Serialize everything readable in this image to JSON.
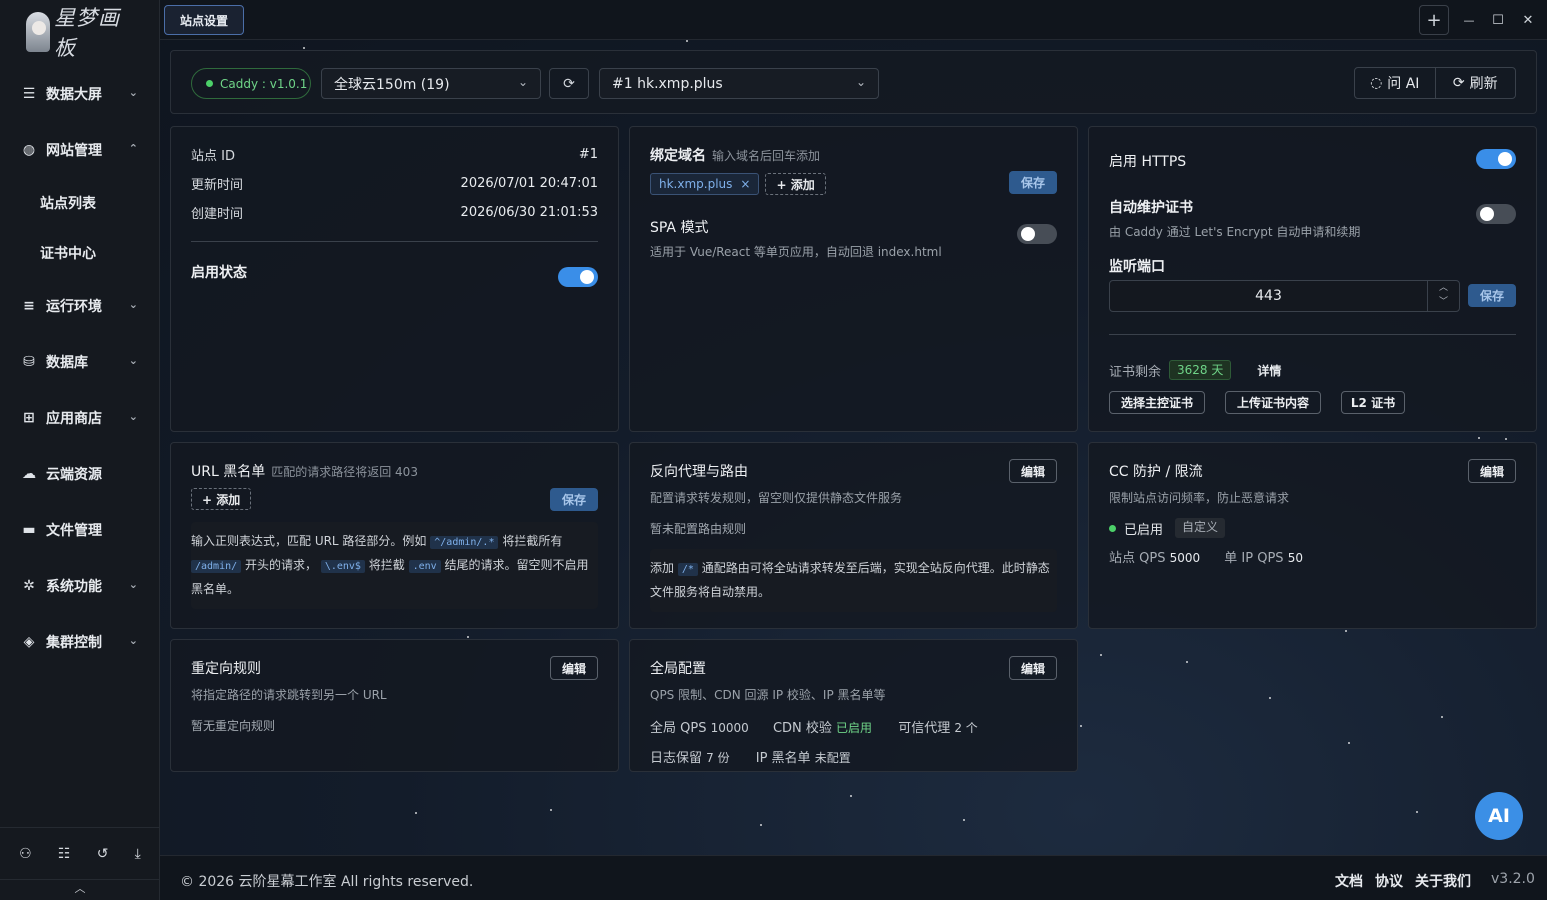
{
  "app": {
    "logo_text": "星梦画板"
  },
  "sidebar": {
    "items": [
      {
        "icon": "bar-chart-icon",
        "glyph": "☰",
        "label": "数据大屏",
        "chevron": "⌄"
      },
      {
        "icon": "globe-icon",
        "glyph": "◍",
        "label": "网站管理",
        "chevron": "⌃"
      },
      {
        "icon": "server-icon",
        "glyph": "≡",
        "label": "运行环境",
        "chevron": "⌄"
      },
      {
        "icon": "database-icon",
        "glyph": "⛁",
        "label": "数据库",
        "chevron": "⌄"
      },
      {
        "icon": "cart-icon",
        "glyph": "⊞",
        "label": "应用商店",
        "chevron": "⌄"
      },
      {
        "icon": "cloud-icon",
        "glyph": "☁",
        "label": "云端资源"
      },
      {
        "icon": "folder-icon",
        "glyph": "▬",
        "label": "文件管理"
      },
      {
        "icon": "gear-icon",
        "glyph": "✲",
        "label": "系统功能",
        "chevron": "⌄"
      },
      {
        "icon": "layers-icon",
        "glyph": "◈",
        "label": "集群控制",
        "chevron": "⌄"
      }
    ],
    "sub_items": [
      "站点列表",
      "证书中心"
    ],
    "footer_icons": [
      {
        "name": "network-icon",
        "glyph": "⚇"
      },
      {
        "name": "list-icon",
        "glyph": "☷"
      },
      {
        "name": "history-icon",
        "glyph": "↺"
      },
      {
        "name": "download-icon",
        "glyph": "⤓"
      }
    ],
    "collapse_glyph": "︿"
  },
  "topbar": {
    "tab_label": "站点设置",
    "plus": "+",
    "minimize": "—",
    "maximize": "☐",
    "close": "✕"
  },
  "toolbar": {
    "status": "Caddy : v1.0.1",
    "server_select": "全球云150m (19)",
    "refresh_glyph": "⟳",
    "site_select": "#1 hk.xmp.plus",
    "ask_ai": "问 AI",
    "refresh": "刷新",
    "chevron": "⌄"
  },
  "info": {
    "site_id_label": "站点 ID",
    "site_id": "#1",
    "updated_label": "更新时间",
    "updated": "2026/07/01 20:47:01",
    "created_label": "创建时间",
    "created": "2026/06/30 21:01:53",
    "enable_label": "启用状态",
    "enabled": true
  },
  "domain": {
    "title": "绑定域名",
    "hint": "输入域名后回车添加",
    "chip": "hk.xmp.plus",
    "add": "+ 添加",
    "save": "保存",
    "spa_title": "SPA 模式",
    "spa_desc": "适用于 Vue/React 等单页应用，自动回退 index.html",
    "spa_enabled": false
  },
  "https": {
    "title": "启用 HTTPS",
    "enabled": true,
    "auto_title": "自动维护证书",
    "auto_desc": "由 Caddy 通过 Let's Encrypt 自动申请和续期",
    "auto_enabled": false,
    "port_title": "监听端口",
    "port": "443",
    "save": "保存",
    "remain_label": "证书剩余",
    "remain": "3628 天",
    "detail": "详情",
    "btn_select": "选择主控证书",
    "btn_upload": "上传证书内容",
    "btn_l2": "L2 证书"
  },
  "blacklist": {
    "title": "URL 黑名单",
    "hint": "匹配的请求路径将返回 403",
    "add": "+ 添加",
    "save": "保存",
    "t1": "输入正则表达式，匹配 URL 路径部分。例如",
    "c1": "^/admin/.*",
    "t2": "将拦截所有",
    "c2": "/admin/",
    "t3": "开头的请求，",
    "c3": "\\.env$",
    "t4": "将拦截",
    "c4": ".env",
    "t5": "结尾的请求。留空则不启用",
    "t6": "黑名单。"
  },
  "proxy": {
    "title": "反向代理与路由",
    "edit": "编辑",
    "desc": "配置请求转发规则，留空则仅提供静态文件服务",
    "empty": "暂未配置路由规则",
    "n1": "添加",
    "code": "/*",
    "n2": "通配路由可将全站请求转发至后端，实现全站反向代理。此时静态",
    "n3": "文件服务将自动禁用。"
  },
  "cc": {
    "title": "CC 防护 / 限流",
    "edit": "编辑",
    "desc": "限制站点访问频率，防止恶意请求",
    "status": "已启用",
    "mode": "自定义",
    "site_qps_label": "站点 QPS",
    "site_qps": "5000",
    "ip_qps_label": "单 IP QPS",
    "ip_qps": "50"
  },
  "redirect": {
    "title": "重定向规则",
    "edit": "编辑",
    "desc": "将指定路径的请求跳转到另一个 URL",
    "empty": "暂无重定向规则"
  },
  "global": {
    "title": "全局配置",
    "edit": "编辑",
    "desc": "QPS 限制、CDN 回源 IP 校验、IP 黑名单等",
    "qps_label": "全局 QPS",
    "qps": "10000",
    "cdn_label": "CDN 校验",
    "cdn": "已启用",
    "proxy_label": "可信代理",
    "proxy": "2 个",
    "log_label": "日志保留",
    "log": "7 份",
    "ipbl_label": "IP 黑名单",
    "ipbl": "未配置"
  },
  "footer": {
    "copyright": "© 2026 云阶星幕工作室 All rights reserved.",
    "docs": "文档",
    "terms": "协议",
    "about": "关于我们",
    "version": "v3.2.0"
  },
  "ai_fab": "AI",
  "colors": {
    "accent": "#3a8ee8",
    "success": "#4cd069",
    "bg": "#0f1622"
  }
}
